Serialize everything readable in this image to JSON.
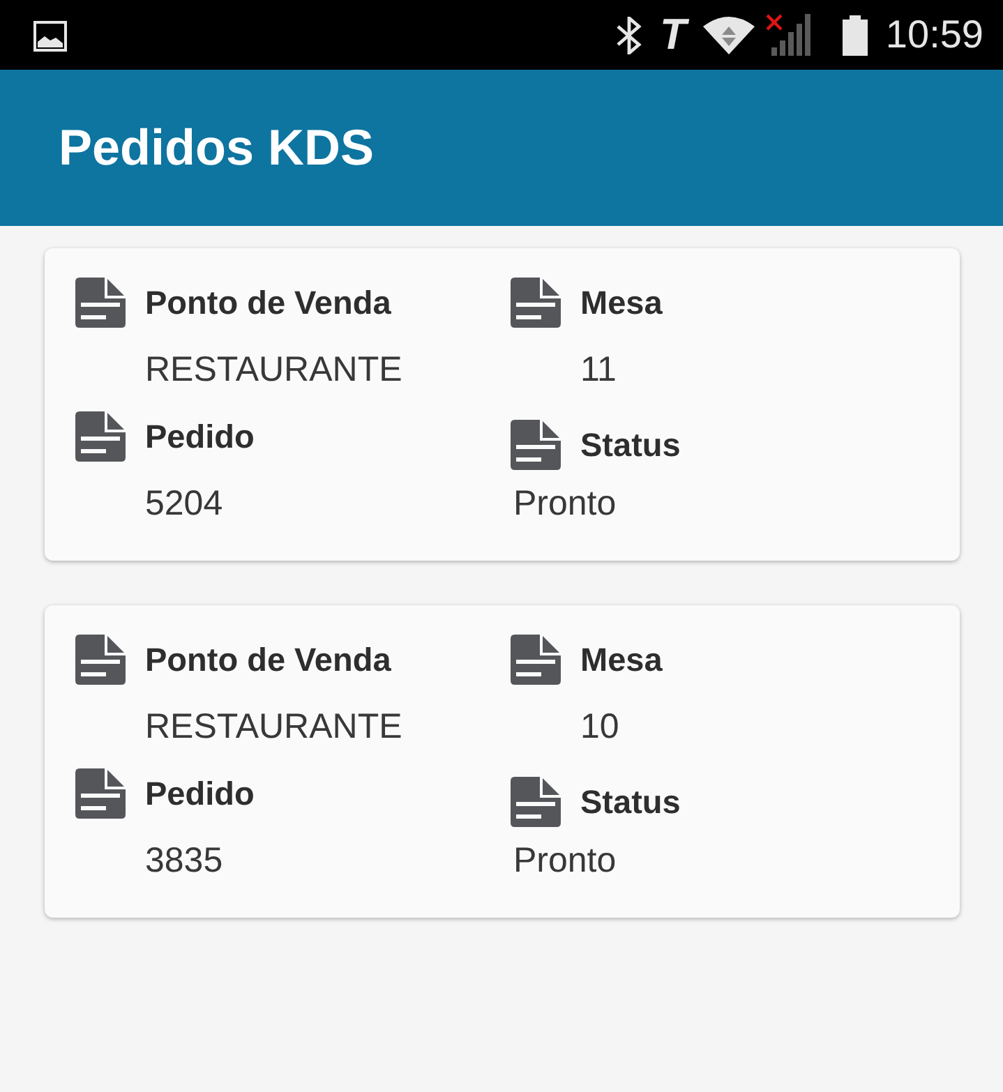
{
  "status_bar": {
    "notification_glyph": "T",
    "time": "10:59"
  },
  "app_bar": {
    "title": "Pedidos KDS"
  },
  "orders": [
    {
      "point_of_sale": {
        "label": "Ponto de Venda",
        "value": "RESTAURANTE"
      },
      "table": {
        "label": "Mesa",
        "value": "11"
      },
      "order_number": {
        "label": "Pedido",
        "value": "5204"
      },
      "status": {
        "label": "Status",
        "value": "Pronto"
      }
    },
    {
      "point_of_sale": {
        "label": "Ponto de Venda",
        "value": "RESTAURANTE"
      },
      "table": {
        "label": "Mesa",
        "value": "10"
      },
      "order_number": {
        "label": "Pedido",
        "value": "3835"
      },
      "status": {
        "label": "Status",
        "value": "Pronto"
      }
    }
  ]
}
